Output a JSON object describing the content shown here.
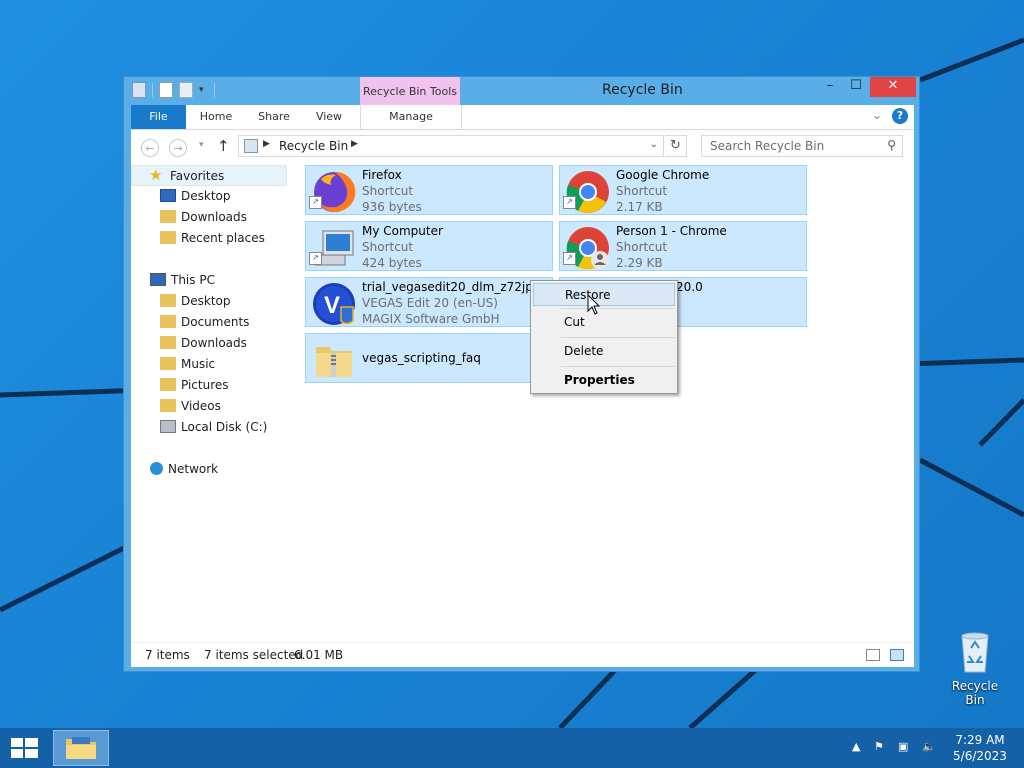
{
  "window": {
    "title": "Recycle Bin",
    "contextual_tab_group": "Recycle Bin Tools",
    "controls": {
      "minimize": "–",
      "maximize": "☐",
      "close": "✕"
    }
  },
  "ribbon": {
    "tabs": [
      "File",
      "Home",
      "Share",
      "View",
      "Manage"
    ],
    "help": "?"
  },
  "address_bar": {
    "path": "Recycle Bin",
    "search_placeholder": "Search Recycle Bin"
  },
  "nav_pane": {
    "favorites_label": "Favorites",
    "favorites": [
      "Desktop",
      "Downloads",
      "Recent places"
    ],
    "this_pc_label": "This PC",
    "this_pc": [
      "Desktop",
      "Documents",
      "Downloads",
      "Music",
      "Pictures",
      "Videos",
      "Local Disk (C:)"
    ],
    "network_label": "Network"
  },
  "files": [
    {
      "name": "Firefox",
      "type": "Shortcut",
      "size": "936 bytes",
      "icon": "firefox-icon"
    },
    {
      "name": "Google Chrome",
      "type": "Shortcut",
      "size": "2.17 KB",
      "icon": "chrome-icon"
    },
    {
      "name": "My Computer",
      "type": "Shortcut",
      "size": "424 bytes",
      "icon": "computer-icon"
    },
    {
      "name": "Person 1 - Chrome",
      "type": "Shortcut",
      "size": "2.29 KB",
      "icon": "chrome-person-icon"
    },
    {
      "name": "trial_vegasedit20_dlm_z72jp2",
      "type": "VEGAS Edit 20 (en-US)",
      "size": "MAGIX Software GmbH",
      "icon": "vegas-icon"
    },
    {
      "name": "20.0",
      "icon": "partially-hidden-tile"
    },
    {
      "name": "vegas_scripting_faq",
      "icon": "zip-folder-icon"
    }
  ],
  "context_menu": {
    "items": [
      "Restore",
      "Cut",
      "Delete",
      "Properties"
    ],
    "highlighted": "Restore"
  },
  "status_bar": {
    "item_count": "7 items",
    "selected": "7 items selected",
    "size": "6.01 MB"
  },
  "desktop": {
    "recycle_bin_label": "Recycle Bin"
  },
  "taskbar": {
    "time": "7:29 AM",
    "date": "5/6/2023"
  },
  "colors": {
    "accent": "#1979ca",
    "selection_fill": "#cce8ff",
    "selection_border": "#99d1ff",
    "close_button": "#e04343",
    "contextual_tab": "#f0c2ee"
  }
}
